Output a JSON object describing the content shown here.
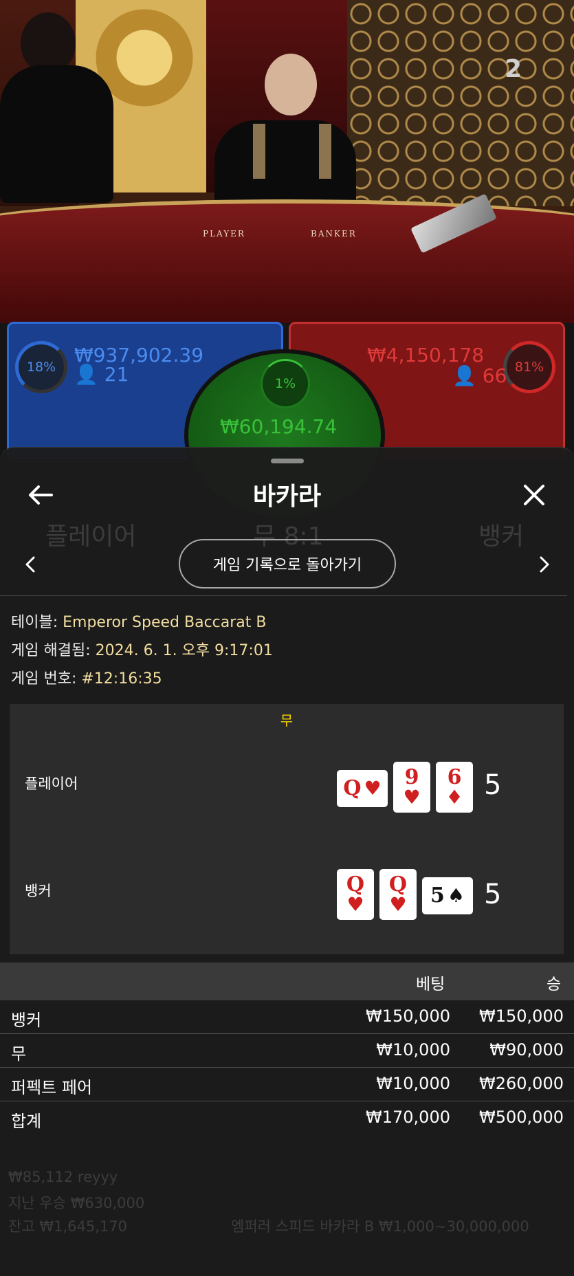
{
  "live": {
    "round_number": "2",
    "felt_player": "PLAYER",
    "felt_banker": "BANKER",
    "player_percent": "18%",
    "player_amount": "₩937,902.39",
    "player_count": "21",
    "banker_percent": "81%",
    "banker_amount": "₩4,150,178",
    "banker_count": "66",
    "tie_percent": "1%",
    "tie_amount": "₩60,194.74",
    "colors": {
      "player": "#2f6bd6",
      "banker": "#c23030",
      "tie": "#1e7a1e",
      "info_value": "#f3dea0",
      "tie_result": "#f5d200"
    }
  },
  "sheet": {
    "title": "바카라",
    "back_icon": "arrow-left-icon",
    "close_icon": "close-icon",
    "history_button": "게임 기록으로 돌아가기"
  },
  "info": {
    "table_label": "테이블:",
    "table_value": "Emperor Speed Baccarat B",
    "resolved_label": "게임 해결됨:",
    "resolved_value": "2024. 6. 1. 오후 9:17:01",
    "game_no_label": "게임 번호:",
    "game_no_value": "#12:16:35"
  },
  "result": {
    "title": "무",
    "player_label": "플레이어",
    "player_score": "5",
    "player_cards": [
      {
        "rank": "Q",
        "suit": "♥",
        "color": "red",
        "sideways": true
      },
      {
        "rank": "9",
        "suit": "♥",
        "color": "red",
        "sideways": false
      },
      {
        "rank": "6",
        "suit": "♦",
        "color": "red",
        "sideways": false
      }
    ],
    "banker_label": "뱅커",
    "banker_score": "5",
    "banker_cards": [
      {
        "rank": "Q",
        "suit": "♥",
        "color": "red",
        "sideways": false
      },
      {
        "rank": "Q",
        "suit": "♥",
        "color": "red",
        "sideways": false
      },
      {
        "rank": "5",
        "suit": "♠",
        "color": "black",
        "sideways": true
      }
    ]
  },
  "bets": {
    "header_bet": "베팅",
    "header_win": "승",
    "rows": [
      {
        "name": "뱅커",
        "bet": "₩150,000",
        "win": "₩150,000"
      },
      {
        "name": "무",
        "bet": "₩10,000",
        "win": "₩90,000"
      },
      {
        "name": "퍼펙트 페어",
        "bet": "₩10,000",
        "win": "₩260,000"
      },
      {
        "name": "합계",
        "bet": "₩170,000",
        "win": "₩500,000"
      }
    ]
  }
}
